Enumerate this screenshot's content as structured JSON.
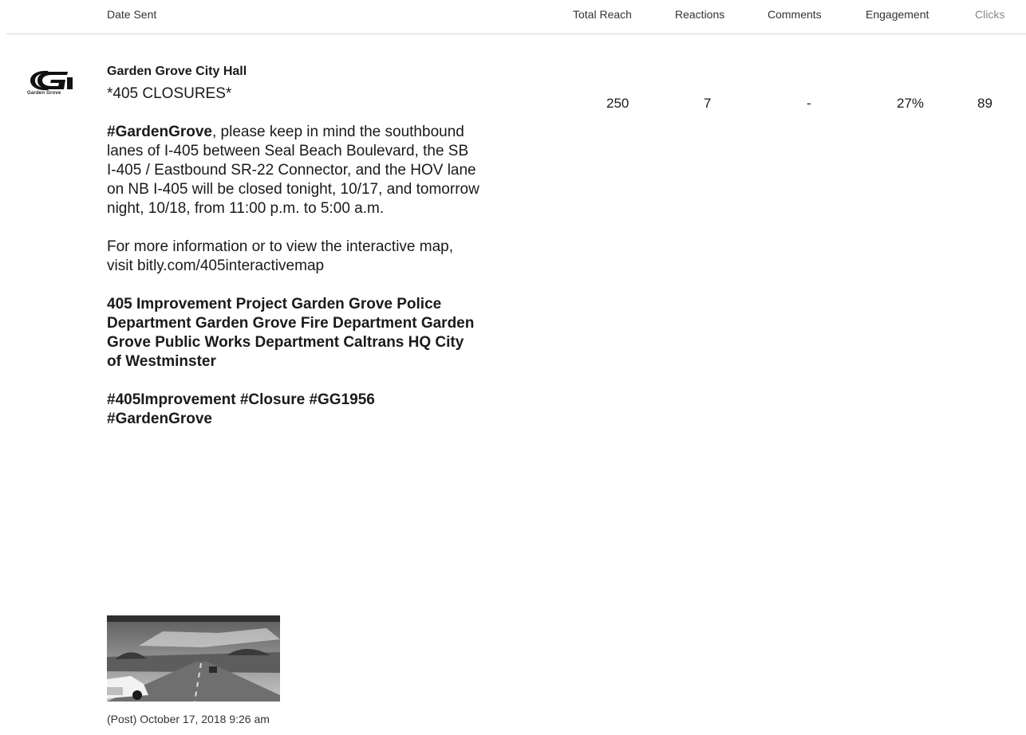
{
  "header": {
    "date_sent": "Date Sent",
    "total_reach": "Total Reach",
    "reactions": "Reactions",
    "comments": "Comments",
    "engagement": "Engagement",
    "clicks": "Clicks"
  },
  "post": {
    "author": "Garden Grove City Hall",
    "logo_caption": "Garden Grove",
    "title": "*405 CLOSURES*",
    "hashtag_lead": "#GardenGrove",
    "body1": ", please keep in mind the southbound lanes of I-405 between Seal Beach Boulevard, the SB I-405 / Eastbound SR-22 Connector, and the HOV lane on NB I-405 will be closed tonight, 10/17, and tomorrow night, 10/18, from 11:00 p.m. to 5:00 a.m.",
    "body2": "For more information or to view the interactive map, visit bitly.com/405interactivemap",
    "tags": "405 Improvement Project Garden Grove Police Department Garden Grove Fire Department Garden Grove Public Works Department Caltrans HQ City of Westminster",
    "hashtags": "#405Improvement #Closure #GG1956 #GardenGrove",
    "sent": "(Post) October 17, 2018 9:26 am"
  },
  "metrics": {
    "total_reach": "250",
    "reactions": "7",
    "comments": "-",
    "engagement": "27%",
    "clicks": "89"
  }
}
